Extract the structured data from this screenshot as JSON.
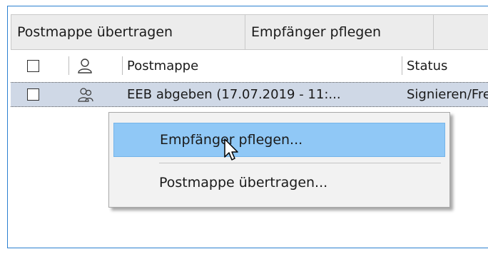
{
  "toolbar": {
    "transfer_label": "Postmappe übertragen",
    "recipients_label": "Empfänger pflegen"
  },
  "table": {
    "columns": [
      "",
      "recipient-icon",
      "Postmappe",
      "Status"
    ],
    "rows": [
      {
        "checked": false,
        "icon": "people-icon",
        "postmappe": "EEB abgeben (17.07.2019 - 11:...",
        "status": "Signieren/Fre"
      }
    ]
  },
  "context_menu": {
    "items": [
      {
        "label": "Empfänger pflegen...",
        "highlighted": true
      },
      {
        "label": "Postmappe übertragen...",
        "highlighted": false
      }
    ]
  },
  "colors": {
    "frame_border": "#2b7fd0",
    "selected_row": "#cfd8e6",
    "menu_highlight": "#90c8f6"
  }
}
